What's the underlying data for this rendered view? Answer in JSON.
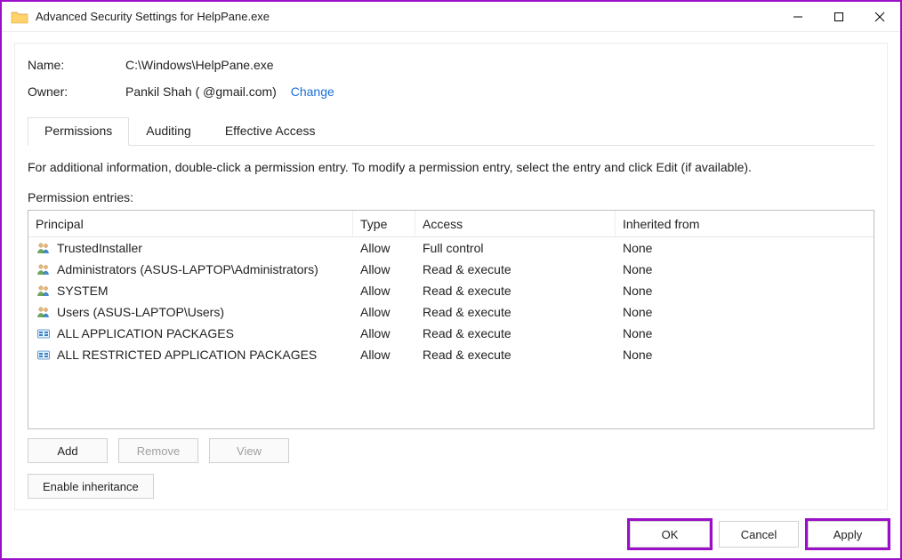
{
  "titlebar": {
    "title": "Advanced Security Settings for HelpPane.exe"
  },
  "header": {
    "name_label": "Name:",
    "name_value": "C:\\Windows\\HelpPane.exe",
    "owner_label": "Owner:",
    "owner_value": "Pankil Shah (                       @gmail.com)",
    "change_link": "Change"
  },
  "tabs": {
    "permissions": "Permissions",
    "auditing": "Auditing",
    "effective": "Effective Access"
  },
  "permissions": {
    "info": "For additional information, double-click a permission entry. To modify a permission entry, select the entry and click Edit (if available).",
    "entries_label": "Permission entries:",
    "columns": {
      "principal": "Principal",
      "type": "Type",
      "access": "Access",
      "inherited": "Inherited from"
    },
    "rows": [
      {
        "icon": "users",
        "principal": "TrustedInstaller",
        "type": "Allow",
        "access": "Full control",
        "inherited": "None"
      },
      {
        "icon": "users",
        "principal": "Administrators (ASUS-LAPTOP\\Administrators)",
        "type": "Allow",
        "access": "Read & execute",
        "inherited": "None"
      },
      {
        "icon": "users",
        "principal": "SYSTEM",
        "type": "Allow",
        "access": "Read & execute",
        "inherited": "None"
      },
      {
        "icon": "users",
        "principal": "Users (ASUS-LAPTOP\\Users)",
        "type": "Allow",
        "access": "Read & execute",
        "inherited": "None"
      },
      {
        "icon": "package",
        "principal": "ALL APPLICATION PACKAGES",
        "type": "Allow",
        "access": "Read & execute",
        "inherited": "None"
      },
      {
        "icon": "package",
        "principal": "ALL RESTRICTED APPLICATION PACKAGES",
        "type": "Allow",
        "access": "Read & execute",
        "inherited": "None"
      }
    ],
    "buttons": {
      "add": "Add",
      "remove": "Remove",
      "view": "View",
      "enable_inherit": "Enable inheritance"
    }
  },
  "footer": {
    "ok": "OK",
    "cancel": "Cancel",
    "apply": "Apply"
  }
}
